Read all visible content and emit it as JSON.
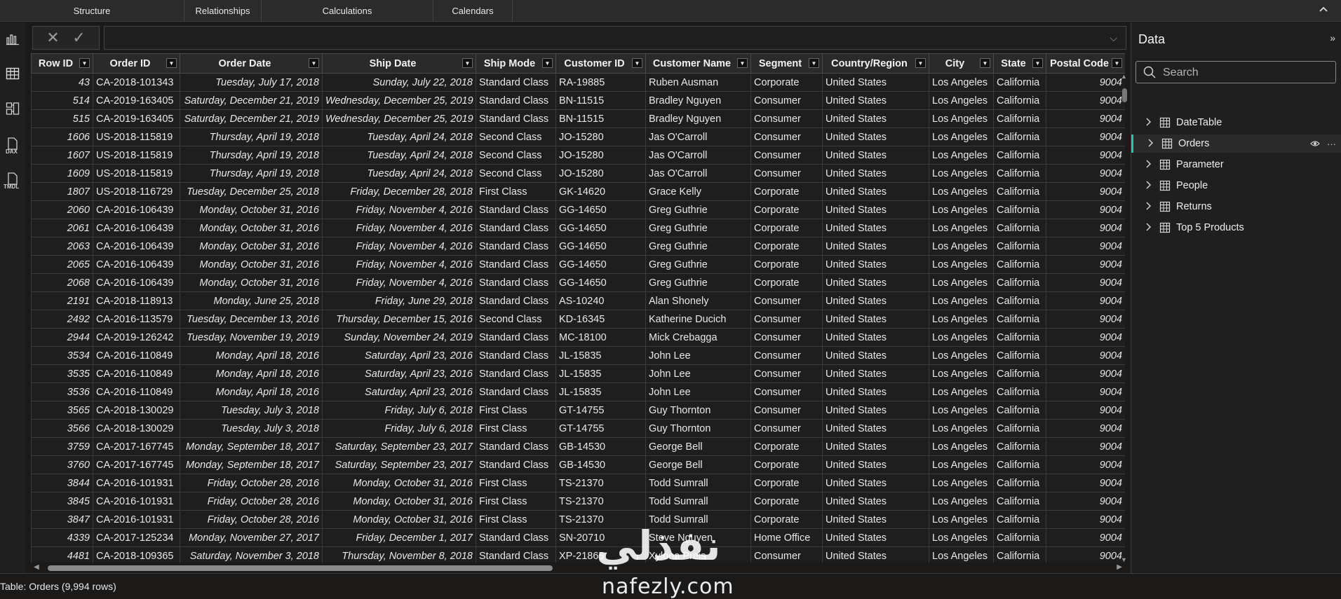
{
  "ribbon": {
    "groups": [
      "Structure",
      "Relationships",
      "Calculations",
      "Calendars"
    ],
    "collapse_icon": "chevron-up-icon"
  },
  "rail": {
    "items": [
      "report-view-icon",
      "table-view-icon",
      "model-view-icon",
      "dax-query-view-icon",
      "tmdl-view-icon"
    ],
    "dax_label": "DAX",
    "tmdl_label": "TMDL"
  },
  "formula_bar": {
    "cancel_glyph": "✕",
    "commit_glyph": "✓",
    "value": "",
    "expand_glyph": "⌵"
  },
  "grid": {
    "columns": [
      "Row ID",
      "Order ID",
      "Order Date",
      "Ship Date",
      "Ship Mode",
      "Customer ID",
      "Customer Name",
      "Segment",
      "Country/Region",
      "City",
      "State",
      "Postal Code"
    ],
    "rows": [
      [
        "43",
        "CA-2018-101343",
        "Tuesday, July 17, 2018",
        "Sunday, July 22, 2018",
        "Standard Class",
        "RA-19885",
        "Ruben Ausman",
        "Corporate",
        "United States",
        "Los Angeles",
        "California",
        "9004"
      ],
      [
        "514",
        "CA-2019-163405",
        "Saturday, December 21, 2019",
        "Wednesday, December 25, 2019",
        "Standard Class",
        "BN-11515",
        "Bradley Nguyen",
        "Consumer",
        "United States",
        "Los Angeles",
        "California",
        "9004"
      ],
      [
        "515",
        "CA-2019-163405",
        "Saturday, December 21, 2019",
        "Wednesday, December 25, 2019",
        "Standard Class",
        "BN-11515",
        "Bradley Nguyen",
        "Consumer",
        "United States",
        "Los Angeles",
        "California",
        "9004"
      ],
      [
        "1606",
        "US-2018-115819",
        "Thursday, April 19, 2018",
        "Tuesday, April 24, 2018",
        "Second Class",
        "JO-15280",
        "Jas O'Carroll",
        "Consumer",
        "United States",
        "Los Angeles",
        "California",
        "9004"
      ],
      [
        "1607",
        "US-2018-115819",
        "Thursday, April 19, 2018",
        "Tuesday, April 24, 2018",
        "Second Class",
        "JO-15280",
        "Jas O'Carroll",
        "Consumer",
        "United States",
        "Los Angeles",
        "California",
        "9004"
      ],
      [
        "1609",
        "US-2018-115819",
        "Thursday, April 19, 2018",
        "Tuesday, April 24, 2018",
        "Second Class",
        "JO-15280",
        "Jas O'Carroll",
        "Consumer",
        "United States",
        "Los Angeles",
        "California",
        "9004"
      ],
      [
        "1807",
        "US-2018-116729",
        "Tuesday, December 25, 2018",
        "Friday, December 28, 2018",
        "First Class",
        "GK-14620",
        "Grace Kelly",
        "Corporate",
        "United States",
        "Los Angeles",
        "California",
        "9004"
      ],
      [
        "2060",
        "CA-2016-106439",
        "Monday, October 31, 2016",
        "Friday, November 4, 2016",
        "Standard Class",
        "GG-14650",
        "Greg Guthrie",
        "Corporate",
        "United States",
        "Los Angeles",
        "California",
        "9004"
      ],
      [
        "2061",
        "CA-2016-106439",
        "Monday, October 31, 2016",
        "Friday, November 4, 2016",
        "Standard Class",
        "GG-14650",
        "Greg Guthrie",
        "Corporate",
        "United States",
        "Los Angeles",
        "California",
        "9004"
      ],
      [
        "2063",
        "CA-2016-106439",
        "Monday, October 31, 2016",
        "Friday, November 4, 2016",
        "Standard Class",
        "GG-14650",
        "Greg Guthrie",
        "Corporate",
        "United States",
        "Los Angeles",
        "California",
        "9004"
      ],
      [
        "2065",
        "CA-2016-106439",
        "Monday, October 31, 2016",
        "Friday, November 4, 2016",
        "Standard Class",
        "GG-14650",
        "Greg Guthrie",
        "Corporate",
        "United States",
        "Los Angeles",
        "California",
        "9004"
      ],
      [
        "2068",
        "CA-2016-106439",
        "Monday, October 31, 2016",
        "Friday, November 4, 2016",
        "Standard Class",
        "GG-14650",
        "Greg Guthrie",
        "Corporate",
        "United States",
        "Los Angeles",
        "California",
        "9004"
      ],
      [
        "2191",
        "CA-2018-118913",
        "Monday, June 25, 2018",
        "Friday, June 29, 2018",
        "Standard Class",
        "AS-10240",
        "Alan Shonely",
        "Consumer",
        "United States",
        "Los Angeles",
        "California",
        "9004"
      ],
      [
        "2492",
        "CA-2016-113579",
        "Tuesday, December 13, 2016",
        "Thursday, December 15, 2016",
        "Second Class",
        "KD-16345",
        "Katherine Ducich",
        "Consumer",
        "United States",
        "Los Angeles",
        "California",
        "9004"
      ],
      [
        "2944",
        "CA-2019-126242",
        "Tuesday, November 19, 2019",
        "Sunday, November 24, 2019",
        "Standard Class",
        "MC-18100",
        "Mick Crebagga",
        "Consumer",
        "United States",
        "Los Angeles",
        "California",
        "9004"
      ],
      [
        "3534",
        "CA-2016-110849",
        "Monday, April 18, 2016",
        "Saturday, April 23, 2016",
        "Standard Class",
        "JL-15835",
        "John Lee",
        "Consumer",
        "United States",
        "Los Angeles",
        "California",
        "9004"
      ],
      [
        "3535",
        "CA-2016-110849",
        "Monday, April 18, 2016",
        "Saturday, April 23, 2016",
        "Standard Class",
        "JL-15835",
        "John Lee",
        "Consumer",
        "United States",
        "Los Angeles",
        "California",
        "9004"
      ],
      [
        "3536",
        "CA-2016-110849",
        "Monday, April 18, 2016",
        "Saturday, April 23, 2016",
        "Standard Class",
        "JL-15835",
        "John Lee",
        "Consumer",
        "United States",
        "Los Angeles",
        "California",
        "9004"
      ],
      [
        "3565",
        "CA-2018-130029",
        "Tuesday, July 3, 2018",
        "Friday, July 6, 2018",
        "First Class",
        "GT-14755",
        "Guy Thornton",
        "Consumer",
        "United States",
        "Los Angeles",
        "California",
        "9004"
      ],
      [
        "3566",
        "CA-2018-130029",
        "Tuesday, July 3, 2018",
        "Friday, July 6, 2018",
        "First Class",
        "GT-14755",
        "Guy Thornton",
        "Consumer",
        "United States",
        "Los Angeles",
        "California",
        "9004"
      ],
      [
        "3759",
        "CA-2017-167745",
        "Monday, September 18, 2017",
        "Saturday, September 23, 2017",
        "Standard Class",
        "GB-14530",
        "George Bell",
        "Corporate",
        "United States",
        "Los Angeles",
        "California",
        "9004"
      ],
      [
        "3760",
        "CA-2017-167745",
        "Monday, September 18, 2017",
        "Saturday, September 23, 2017",
        "Standard Class",
        "GB-14530",
        "George Bell",
        "Corporate",
        "United States",
        "Los Angeles",
        "California",
        "9004"
      ],
      [
        "3844",
        "CA-2016-101931",
        "Friday, October 28, 2016",
        "Monday, October 31, 2016",
        "First Class",
        "TS-21370",
        "Todd Sumrall",
        "Corporate",
        "United States",
        "Los Angeles",
        "California",
        "9004"
      ],
      [
        "3845",
        "CA-2016-101931",
        "Friday, October 28, 2016",
        "Monday, October 31, 2016",
        "First Class",
        "TS-21370",
        "Todd Sumrall",
        "Corporate",
        "United States",
        "Los Angeles",
        "California",
        "9004"
      ],
      [
        "3847",
        "CA-2016-101931",
        "Friday, October 28, 2016",
        "Monday, October 31, 2016",
        "First Class",
        "TS-21370",
        "Todd Sumrall",
        "Corporate",
        "United States",
        "Los Angeles",
        "California",
        "9004"
      ],
      [
        "4339",
        "CA-2017-125234",
        "Monday, November 27, 2017",
        "Friday, December 1, 2017",
        "Standard Class",
        "SN-20710",
        "Steve Nguyen",
        "Home Office",
        "United States",
        "Los Angeles",
        "California",
        "9004"
      ],
      [
        "4481",
        "CA-2018-109365",
        "Saturday, November 3, 2018",
        "Thursday, November 8, 2018",
        "Standard Class",
        "XP-21865",
        "Xylona Preis",
        "Consumer",
        "United States",
        "Los Angeles",
        "California",
        "9004"
      ]
    ]
  },
  "data_pane": {
    "title": "Data",
    "collapse_glyph": "»",
    "search_placeholder": "Search",
    "tables": [
      {
        "name": "DateTable",
        "active": false
      },
      {
        "name": "Orders",
        "active": true
      },
      {
        "name": "Parameter",
        "active": false
      },
      {
        "name": "People",
        "active": false
      },
      {
        "name": "Returns",
        "active": false
      },
      {
        "name": "Top 5 Products",
        "active": false
      }
    ],
    "accent_color": "#20c9a8"
  },
  "status_bar": {
    "label": "Table: Orders (9,994 rows)"
  },
  "watermark": {
    "arabic": "نفذلي",
    "latin": "nafezly.com"
  }
}
